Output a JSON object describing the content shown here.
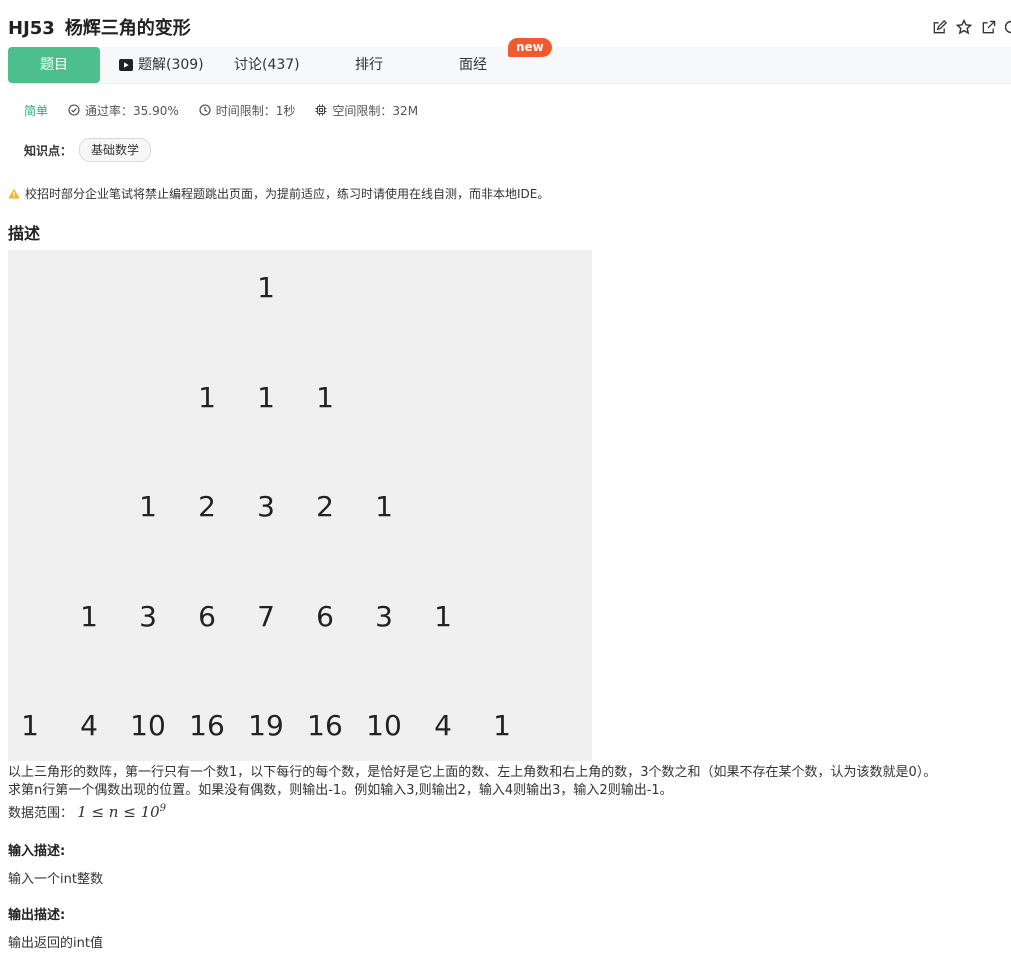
{
  "problem": {
    "code": "HJ53",
    "name": "杨辉三角的变形"
  },
  "tabs": [
    {
      "label": "题目"
    },
    {
      "label": "题解(309)"
    },
    {
      "label": "讨论(437)"
    },
    {
      "label": "排行"
    },
    {
      "label": "面经"
    }
  ],
  "new_badge": "new",
  "meta": {
    "difficulty": "简单",
    "pass_rate": "通过率：35.90%",
    "time_limit": "时间限制：1秒",
    "space_limit": "空间限制：32M"
  },
  "knowledge": {
    "label": "知识点：",
    "tag": "基础数学"
  },
  "warning": "校招时部分企业笔试将禁止编程题跳出页面，为提前适应，练习时请使用在线自测，而非本地IDE。",
  "description": {
    "heading": "描述",
    "triangle": [
      [
        "1"
      ],
      [
        "1",
        "1",
        "1"
      ],
      [
        "1",
        "2",
        "3",
        "2",
        "1"
      ],
      [
        "1",
        "3",
        "6",
        "7",
        "6",
        "3",
        "1"
      ],
      [
        "1",
        "4",
        "10",
        "16",
        "19",
        "16",
        "10",
        "4",
        "1"
      ]
    ],
    "line1": "以上三角形的数阵，第一行只有一个数1，以下每行的每个数，是恰好是它上面的数、左上角数和右上角的数，3个数之和（如果不存在某个数，认为该数就是0）。",
    "line2": "求第n行第一个偶数出现的位置。如果没有偶数，则输出-1。例如输入3,则输出2，输入4则输出3，输入2则输出-1。",
    "range_label": "数据范围：",
    "range_math": "1 ≤ n ≤ 10",
    "range_exp": "9"
  },
  "input": {
    "heading": "输入描述:",
    "text": "输入一个int整数"
  },
  "output": {
    "heading": "输出描述:",
    "text": "输出返回的int值"
  }
}
